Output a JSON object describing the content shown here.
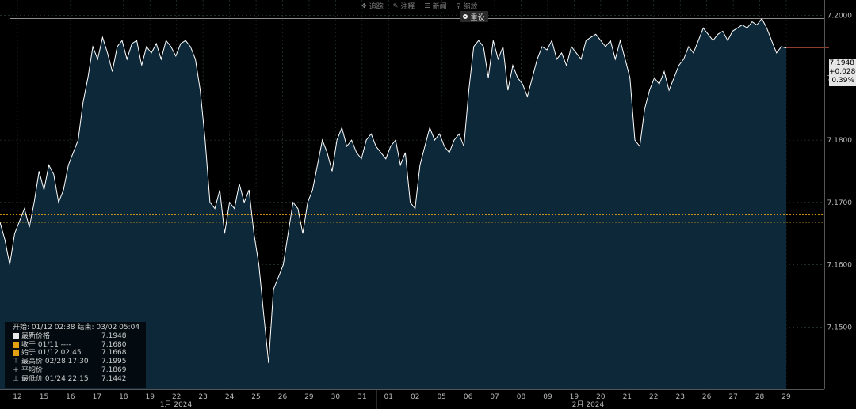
{
  "toolbar": {
    "items": [
      {
        "label": "追踪",
        "icon": "crosshair-icon",
        "glyph": "✥"
      },
      {
        "label": "注释",
        "icon": "pencil-icon",
        "glyph": "✎"
      },
      {
        "label": "新闻",
        "icon": "news-icon",
        "glyph": "☰"
      },
      {
        "label": "缩放",
        "icon": "zoom-icon",
        "glyph": "⚲"
      }
    ],
    "reset_label": "重设"
  },
  "price_tag": {
    "price": "7.1948",
    "change": "+0.0280",
    "pct": "0.39%"
  },
  "legend": {
    "range": "开始: 01/12 02:38 结束: 03/02 05:04",
    "rows": [
      {
        "kind": "swatch",
        "color": "#e8e8e8",
        "label": "最新价格",
        "value": "7.1948"
      },
      {
        "kind": "swatch",
        "color": "#e0a010",
        "label": "收于 01/11 ----",
        "value": "7.1680"
      },
      {
        "kind": "swatch",
        "color": "#e0a010",
        "label": "始于 01/12 02:45",
        "value": "7.1668"
      },
      {
        "kind": "glyph",
        "glyph": "⊤",
        "label": "最高价 02/28 17:30",
        "value": "7.1995"
      },
      {
        "kind": "glyph",
        "glyph": "+",
        "label": "平均价",
        "value": "7.1869"
      },
      {
        "kind": "glyph",
        "glyph": "⊥",
        "label": "最低价 01/24 22:15",
        "value": "7.1442"
      }
    ]
  },
  "colors": {
    "line": "#ffffff",
    "area": "#0d2a3c",
    "grid": "#3b5a5a",
    "ref_orange": "#e0a010",
    "high_line": "#bdbdbd"
  },
  "chart_data": {
    "type": "line",
    "ylim": [
      7.14,
      7.2025
    ],
    "y_ticks": [
      7.15,
      7.16,
      7.17,
      7.18,
      7.19,
      7.2
    ],
    "y_tick_labels": [
      "7.1500",
      "7.1600",
      "7.1700",
      "7.1800",
      "7.1900",
      "7.2000"
    ],
    "day_labels": [
      "12",
      "15",
      "16",
      "17",
      "18",
      "19",
      "22",
      "23",
      "24",
      "25",
      "26",
      "29",
      "30",
      "31",
      "01",
      "02",
      "05",
      "06",
      "07",
      "08",
      "09",
      "19",
      "20",
      "21",
      "22",
      "23",
      "26",
      "27",
      "28",
      "29"
    ],
    "month_labels": [
      "1月 2024",
      "2月 2024"
    ],
    "reference_lines": {
      "prev_close": 7.168,
      "open": 7.1668,
      "high": 7.1995
    },
    "series": [
      {
        "values": [
          7.1668,
          7.164,
          7.16,
          7.165,
          7.167,
          7.169,
          7.166,
          7.17,
          7.175,
          7.172,
          7.176,
          7.1745,
          7.17,
          7.172,
          7.176,
          7.178,
          7.18,
          7.186,
          7.19,
          7.195,
          7.193,
          7.1965,
          7.194,
          7.191,
          7.195,
          7.196,
          7.193,
          7.1955,
          7.196,
          7.192,
          7.195,
          7.194,
          7.1955,
          7.193,
          7.196,
          7.195,
          7.1935,
          7.1955,
          7.196,
          7.195,
          7.193,
          7.188,
          7.18,
          7.17,
          7.169,
          7.172,
          7.165,
          7.17,
          7.169,
          7.173,
          7.17,
          7.172,
          7.165,
          7.16,
          7.152,
          7.1442,
          7.156,
          7.158,
          7.16,
          7.165,
          7.17,
          7.169,
          7.165,
          7.17,
          7.172,
          7.176,
          7.18,
          7.178,
          7.175,
          7.18,
          7.182,
          7.179,
          7.18,
          7.178,
          7.177,
          7.18,
          7.181,
          7.179,
          7.178,
          7.177,
          7.179,
          7.18,
          7.176,
          7.178,
          7.17,
          7.169,
          7.176,
          7.179,
          7.182,
          7.18,
          7.181,
          7.179,
          7.178,
          7.18,
          7.181,
          7.179,
          7.188,
          7.195,
          7.196,
          7.195,
          7.19,
          7.196,
          7.193,
          7.195,
          7.188,
          7.192,
          7.19,
          7.189,
          7.187,
          7.19,
          7.193,
          7.195,
          7.1945,
          7.196,
          7.193,
          7.194,
          7.192,
          7.195,
          7.194,
          7.193,
          7.196,
          7.1965,
          7.197,
          7.196,
          7.195,
          7.196,
          7.193,
          7.196,
          7.193,
          7.19,
          7.18,
          7.179,
          7.185,
          7.188,
          7.19,
          7.189,
          7.191,
          7.188,
          7.19,
          7.192,
          7.193,
          7.195,
          7.194,
          7.196,
          7.198,
          7.197,
          7.196,
          7.197,
          7.1975,
          7.196,
          7.1975,
          7.198,
          7.1985,
          7.198,
          7.199,
          7.1985,
          7.1995,
          7.198,
          7.196,
          7.194,
          7.195,
          7.1948
        ]
      }
    ]
  }
}
